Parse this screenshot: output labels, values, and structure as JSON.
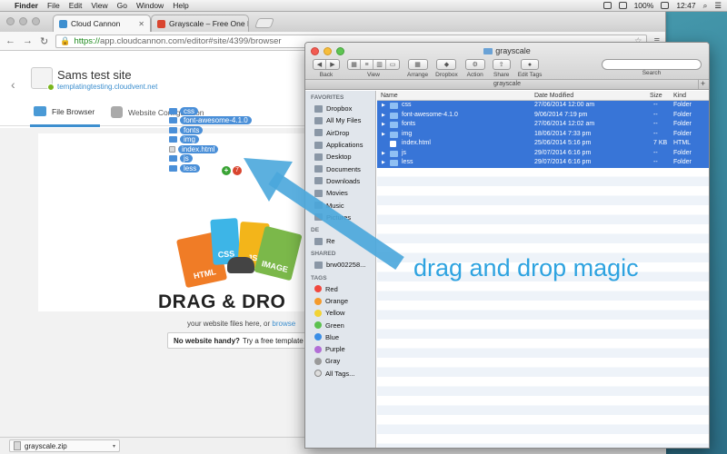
{
  "menubar": {
    "app": "Finder",
    "items": [
      "File",
      "Edit",
      "View",
      "Go",
      "Window",
      "Help"
    ],
    "battery": "100%",
    "time": "12:47"
  },
  "browser": {
    "tabs": [
      {
        "label": "Cloud Cannon",
        "favicon_color": "#3d8fcf"
      },
      {
        "label": "Grayscale – Free One Page",
        "favicon_color": "#d9452f"
      }
    ],
    "url_scheme": "https://",
    "url_rest": "app.cloudcannon.com/editor#site/4399/browser"
  },
  "site": {
    "title": "Sams test site",
    "subdomain": "templatingtesting.cloudvent.net",
    "tabs": [
      "File Browser",
      "Website Configuration"
    ],
    "drag_items": [
      {
        "label": "css",
        "kind": "folder"
      },
      {
        "label": "font-awesome-4.1.0",
        "kind": "folder"
      },
      {
        "label": "fonts",
        "kind": "folder"
      },
      {
        "label": "img",
        "kind": "folder"
      },
      {
        "label": "index.html",
        "kind": "file"
      },
      {
        "label": "js",
        "kind": "folder"
      },
      {
        "label": "less",
        "kind": "folder"
      }
    ],
    "drag_plus": "+",
    "drag_count": "7",
    "card_labels": {
      "html": "HTML",
      "css": "CSS",
      "js": "JS",
      "image": "IMAGE"
    },
    "dropzone_title": "DRAG & DRO",
    "dropzone_sub_prefix": "your website files here, or",
    "dropzone_sub_link": "browse",
    "template_button_bold": "No website handy?",
    "template_button_rest": "Try a free template"
  },
  "downloads": {
    "file": "grayscale.zip"
  },
  "finder": {
    "title": "grayscale",
    "toolbar": {
      "back": "Back",
      "view": "View",
      "arrange": "Arrange",
      "dropbox": "Dropbox",
      "action": "Action",
      "share": "Share",
      "edit_tags": "Edit Tags",
      "search": "Search"
    },
    "path": "grayscale",
    "sidebar": {
      "favorites_header": "FAVORITES",
      "favorites": [
        "Dropbox",
        "All My Files",
        "AirDrop",
        "Applications",
        "Desktop",
        "Documents",
        "Downloads",
        "Movies",
        "Music",
        "Pictures"
      ],
      "devices_header": "DE",
      "devices": [
        "Re"
      ],
      "shared_header": "SHARED",
      "shared": [
        "brw002258..."
      ],
      "tags_header": "TAGS",
      "tags": [
        {
          "label": "Red",
          "color": "#f0483e"
        },
        {
          "label": "Orange",
          "color": "#f49a2b"
        },
        {
          "label": "Yellow",
          "color": "#f2d335"
        },
        {
          "label": "Green",
          "color": "#5cc14f"
        },
        {
          "label": "Blue",
          "color": "#3b8ee6"
        },
        {
          "label": "Purple",
          "color": "#b26ed6"
        },
        {
          "label": "Gray",
          "color": "#9a9a9a"
        },
        {
          "label": "All Tags...",
          "color": ""
        }
      ]
    },
    "columns": {
      "name": "Name",
      "date": "Date Modified",
      "size": "Size",
      "kind": "Kind"
    },
    "rows": [
      {
        "name": "css",
        "date": "27/06/2014 12:00 am",
        "size": "--",
        "kind": "Folder",
        "folder": true
      },
      {
        "name": "font-awesome-4.1.0",
        "date": "9/06/2014 7:19 pm",
        "size": "--",
        "kind": "Folder",
        "folder": true
      },
      {
        "name": "fonts",
        "date": "27/06/2014 12:02 am",
        "size": "--",
        "kind": "Folder",
        "folder": true
      },
      {
        "name": "img",
        "date": "18/06/2014 7:33 pm",
        "size": "--",
        "kind": "Folder",
        "folder": true
      },
      {
        "name": "index.html",
        "date": "25/06/2014 5:16 pm",
        "size": "7 KB",
        "kind": "HTML",
        "folder": false
      },
      {
        "name": "js",
        "date": "29/07/2014 6:16 pm",
        "size": "--",
        "kind": "Folder",
        "folder": true
      },
      {
        "name": "less",
        "date": "29/07/2014 6:16 pm",
        "size": "--",
        "kind": "Folder",
        "folder": true
      }
    ]
  },
  "annotation": {
    "text": "drag and drop magic",
    "color": "#2ea3e0"
  }
}
